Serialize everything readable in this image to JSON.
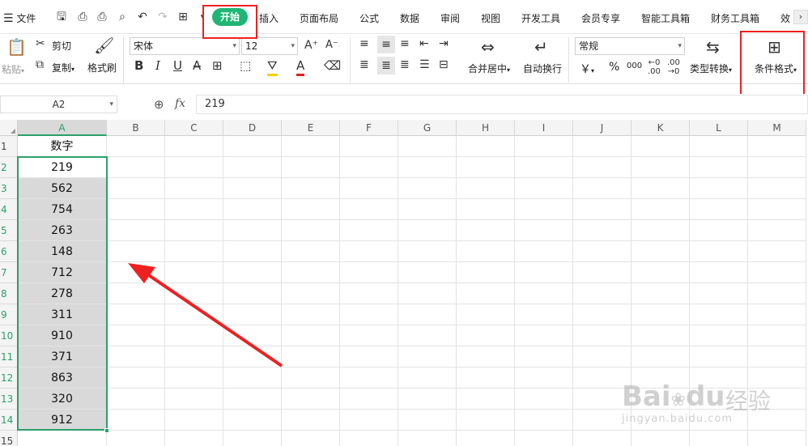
{
  "menubar": {
    "file_label": "文件",
    "tabs": [
      "开始",
      "插入",
      "页面布局",
      "公式",
      "数据",
      "审阅",
      "视图",
      "开发工具",
      "会员专享",
      "智能工具箱",
      "财务工具箱",
      "效"
    ],
    "active_tab": "开始"
  },
  "ribbon": {
    "paste_label": "粘贴",
    "cut_label": "剪切",
    "copy_label": "复制",
    "format_painter_label": "格式刷",
    "font_name": "宋体",
    "font_size": "12",
    "merge_center_label": "合并居中",
    "wrap_text_label": "自动换行",
    "number_format": "常规",
    "currency_symbol": "￥",
    "percent_symbol": "%",
    "thousands_symbol": "000",
    "convert_type_label": "类型转换",
    "conditional_format_label": "条件格式"
  },
  "formula_bar": {
    "name_box": "A2",
    "fx_label": "fx",
    "value": "219"
  },
  "sheet": {
    "columns": [
      "A",
      "B",
      "C",
      "D",
      "E",
      "F",
      "G",
      "H",
      "I",
      "J",
      "K",
      "L",
      "M"
    ],
    "rows": [
      "1",
      "2",
      "3",
      "4",
      "5",
      "6",
      "7",
      "8",
      "9",
      "10",
      "11",
      "12",
      "13",
      "14",
      "15"
    ],
    "header_cell": "数字",
    "values": [
      "219",
      "562",
      "754",
      "263",
      "148",
      "712",
      "278",
      "311",
      "910",
      "371",
      "863",
      "320",
      "912"
    ]
  },
  "watermark": {
    "brand": "Bai",
    "brand2": "du",
    "cn": "经验",
    "url": "jingyan.baidu.com"
  },
  "colors": {
    "accent_green": "#1fb574",
    "annotation_red": "#ef2020",
    "selection_fill": "#d9d9d9"
  }
}
